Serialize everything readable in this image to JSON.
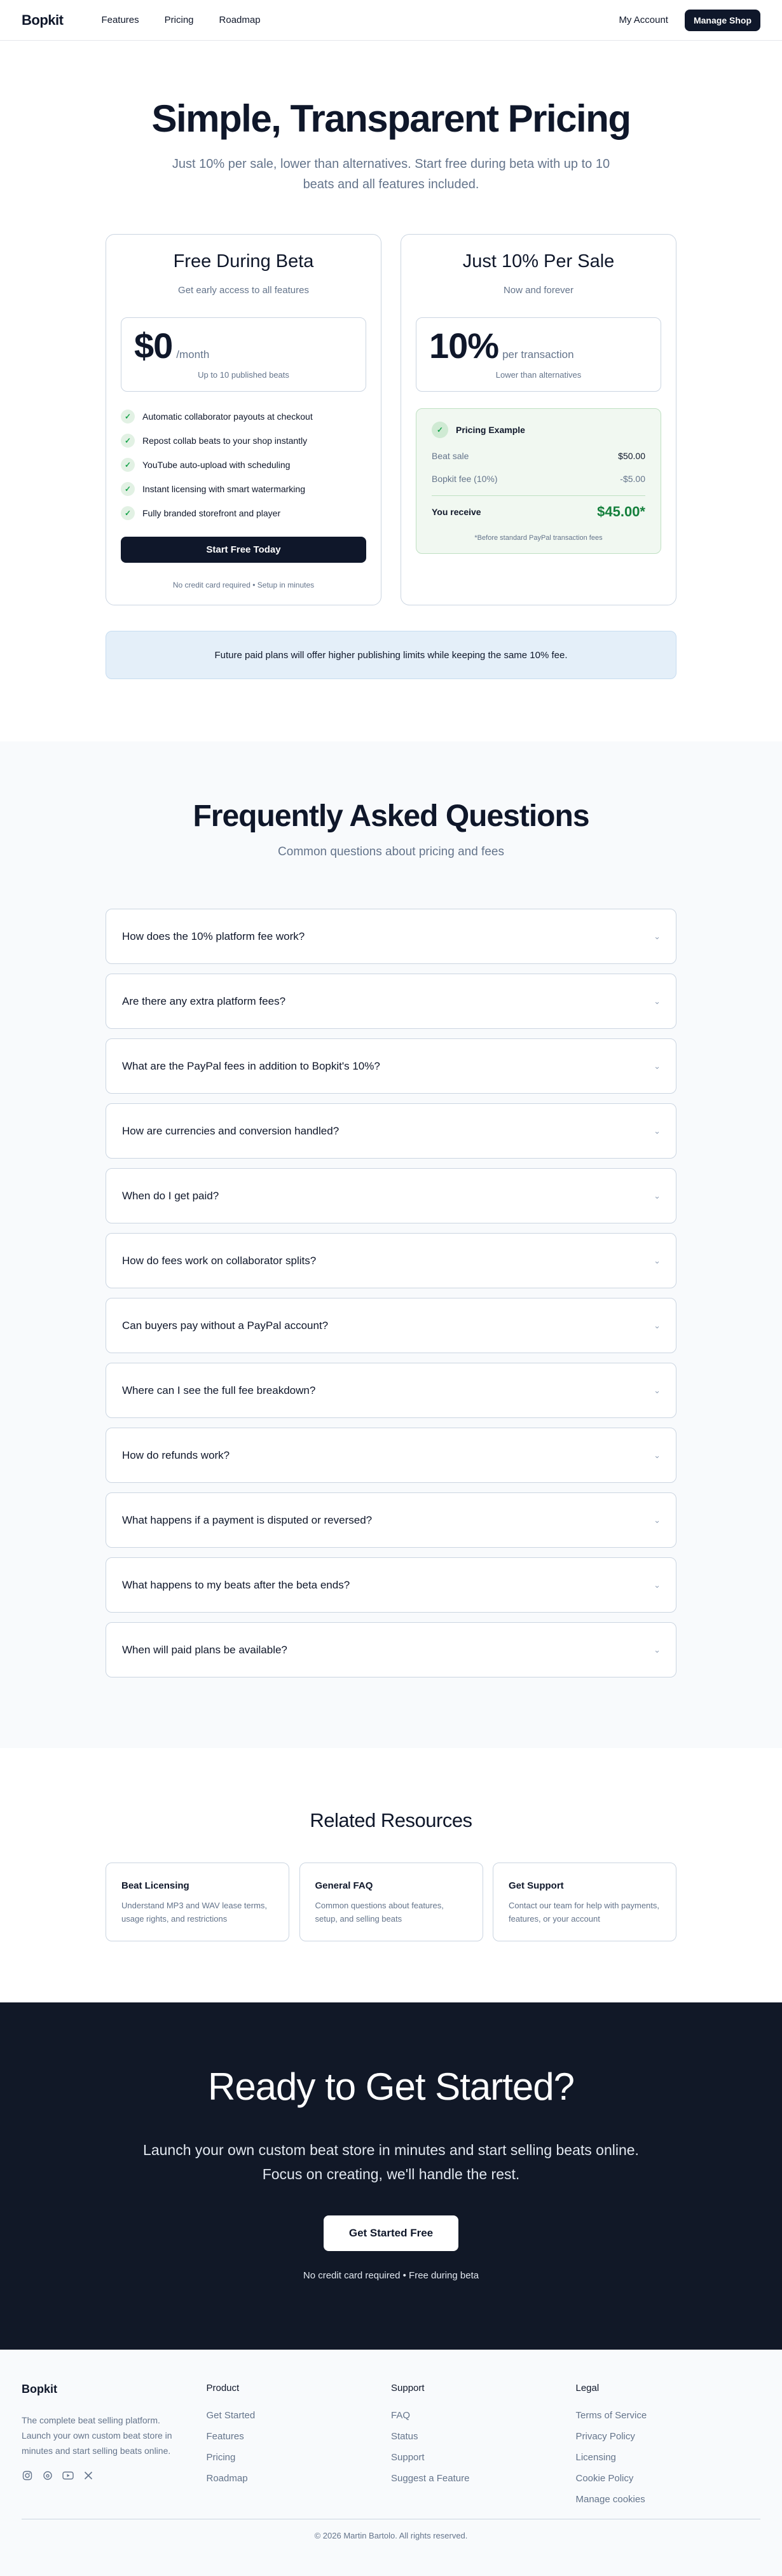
{
  "nav": {
    "brand": "Bopkit",
    "links": [
      "Features",
      "Pricing",
      "Roadmap"
    ],
    "account": "My Account",
    "manage": "Manage Shop"
  },
  "hero": {
    "title": "Simple, Transparent Pricing",
    "subtitle": "Just 10% per sale, lower than alternatives. Start free during beta with up to 10 beats and all features included."
  },
  "plans": {
    "free": {
      "title": "Free During Beta",
      "subtitle": "Get early access to all features",
      "price": "$0",
      "unit": "/month",
      "note": "Up to 10 published beats",
      "features": [
        "Automatic collaborator payouts at checkout",
        "Repost collab beats to your shop instantly",
        "YouTube auto-upload with scheduling",
        "Instant licensing with smart watermarking",
        "Fully branded storefront and player"
      ],
      "cta": "Start Free Today",
      "fineprint": "No credit card required • Setup in minutes"
    },
    "sale": {
      "title": "Just 10% Per Sale",
      "subtitle": "Now and forever",
      "price": "10%",
      "unit": "per transaction",
      "note": "Lower than alternatives",
      "example": {
        "title": "Pricing Example",
        "rows": [
          {
            "label": "Beat sale",
            "value": "$50.00"
          },
          {
            "label": "Bopkit fee (10%)",
            "value": "-$5.00"
          }
        ],
        "total_label": "You receive",
        "total_value": "$45.00*",
        "footnote": "*Before standard PayPal transaction fees"
      }
    }
  },
  "notice": "Future paid plans will offer higher publishing limits while keeping the same 10% fee.",
  "faq": {
    "title": "Frequently Asked Questions",
    "subtitle": "Common questions about pricing and fees",
    "items": [
      "How does the 10% platform fee work?",
      "Are there any extra platform fees?",
      "What are the PayPal fees in addition to Bopkit's 10%?",
      "How are currencies and conversion handled?",
      "When do I get paid?",
      "How do fees work on collaborator splits?",
      "Can buyers pay without a PayPal account?",
      "Where can I see the full fee breakdown?",
      "How do refunds work?",
      "What happens if a payment is disputed or reversed?",
      "What happens to my beats after the beta ends?",
      "When will paid plans be available?"
    ]
  },
  "related": {
    "title": "Related Resources",
    "cards": [
      {
        "title": "Beat Licensing",
        "desc": "Understand MP3 and WAV lease terms, usage rights, and restrictions"
      },
      {
        "title": "General FAQ",
        "desc": "Common questions about features, setup, and selling beats"
      },
      {
        "title": "Get Support",
        "desc": "Contact our team for help with payments, features, or your account"
      }
    ]
  },
  "cta": {
    "title": "Ready to Get Started?",
    "text": "Launch your own custom beat store in minutes and start selling beats online. Focus on creating, we'll handle the rest.",
    "button": "Get Started Free",
    "note": "No credit card required • Free during beta"
  },
  "footer": {
    "brand": "Bopkit",
    "description": "The complete beat selling platform. Launch your own custom beat store in minutes and start selling beats online.",
    "columns": [
      {
        "title": "Product",
        "links": [
          "Get Started",
          "Features",
          "Pricing",
          "Roadmap"
        ]
      },
      {
        "title": "Support",
        "links": [
          "FAQ",
          "Status",
          "Support",
          "Suggest a Feature"
        ]
      },
      {
        "title": "Legal",
        "links": [
          "Terms of Service",
          "Privacy Policy",
          "Licensing",
          "Cookie Policy",
          "Manage cookies"
        ]
      }
    ],
    "copyright": "© 2026 Martin Bartolo. All rights reserved."
  },
  "colors": {
    "primary": "#0f172a",
    "accent_green": "#15803d",
    "muted": "#64748b",
    "cta_bg": "#111827"
  }
}
